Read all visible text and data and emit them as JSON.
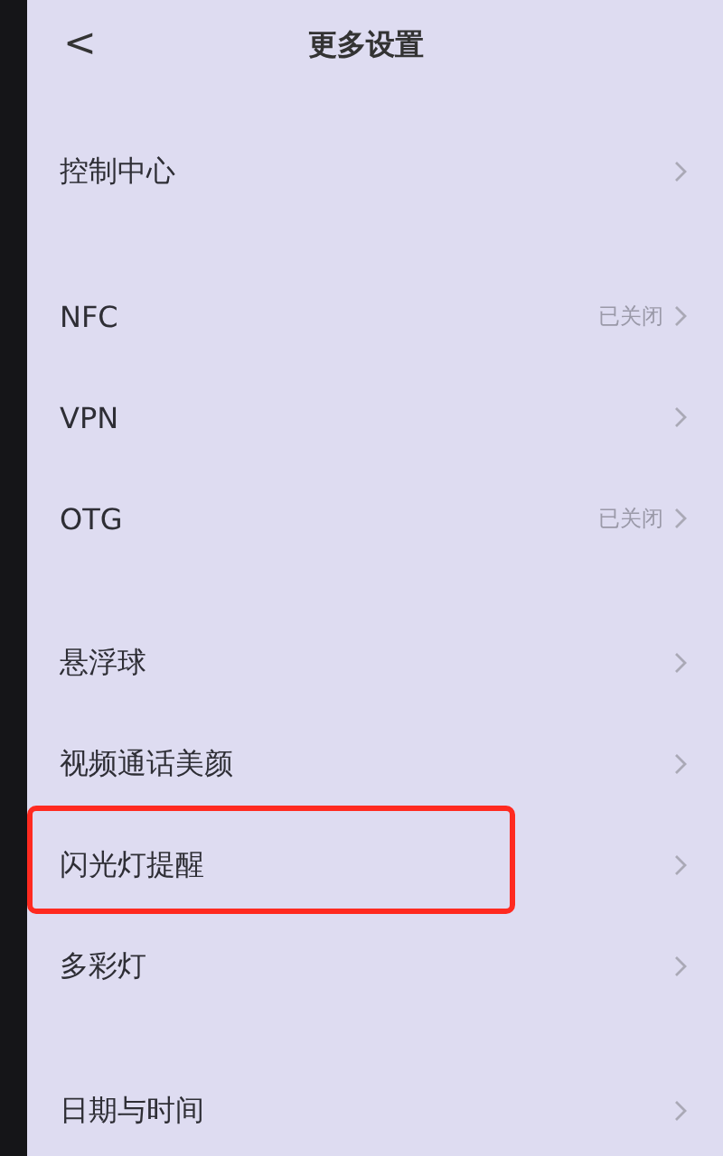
{
  "header": {
    "back": "<",
    "title": "更多设置"
  },
  "sections": [
    {
      "items": [
        {
          "label": "控制中心",
          "highlighted": false
        }
      ]
    },
    {
      "items": [
        {
          "label": "NFC",
          "value": "已关闭",
          "highlighted": false
        },
        {
          "label": "VPN",
          "highlighted": false
        },
        {
          "label": "OTG",
          "value": "已关闭",
          "highlighted": false
        }
      ]
    },
    {
      "items": [
        {
          "label": "悬浮球",
          "highlighted": false
        },
        {
          "label": "视频通话美颜",
          "highlighted": false
        },
        {
          "label": "闪光灯提醒",
          "highlighted": true
        },
        {
          "label": "多彩灯",
          "highlighted": false
        }
      ]
    },
    {
      "items": [
        {
          "label": "日期与时间",
          "highlighted": false
        }
      ]
    }
  ]
}
